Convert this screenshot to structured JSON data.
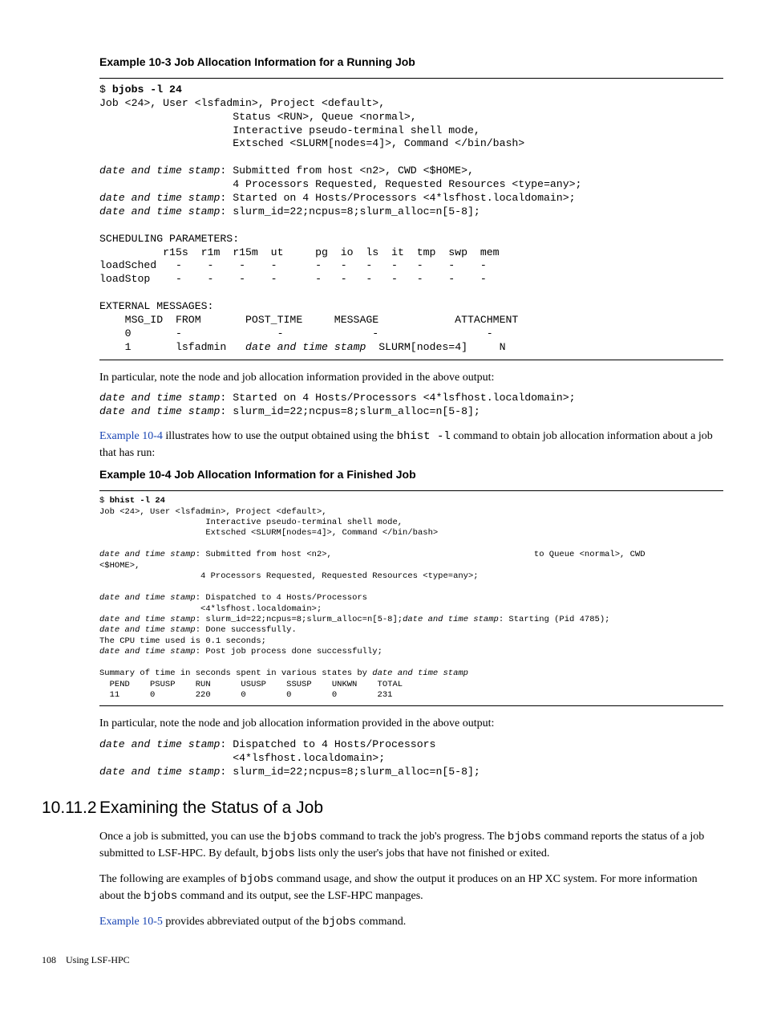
{
  "example103": {
    "heading": "Example 10-3 Job Allocation Information for a Running Job",
    "block": "$ <b>bjobs -l 24</b>\nJob <24>, User <lsfadmin>, Project <default>,\n                     Status <RUN>, Queue <normal>,\n                     Interactive pseudo-terminal shell mode,\n                     Extsched <SLURM[nodes=4]>, Command </bin/bash>\n\n<i>date and time stamp</i>: Submitted from host <n2>, CWD <$HOME>,\n                     4 Processors Requested, Requested Resources <type=any>;\n<i>date and time stamp</i>: Started on 4 Hosts/Processors <4*lsfhost.localdomain>;\n<i>date and time stamp</i>: slurm_id=22;ncpus=8;slurm_alloc=n[5-8];\n\nSCHEDULING PARAMETERS:\n          r15s  r1m  r15m  ut     pg  io  ls  it  tmp  swp  mem\nloadSched   -    -    -    -      -   -   -   -   -    -    -\nloadStop    -    -    -    -      -   -   -   -   -    -    -\n\nEXTERNAL MESSAGES:\n    MSG_ID  FROM       POST_TIME     MESSAGE            ATTACHMENT\n    0       -               -              -                 -\n    1       lsfadmin   <i>date and time stamp</i>  SLURM[nodes=4]     N"
  },
  "para1": "In particular, note the node and job allocation information provided in the above output:",
  "snippet1": "<i>date and time stamp</i>: Started on 4 Hosts/Processors <4*lsfhost.localdomain>;\n<i>date and time stamp</i>: slurm_id=22;ncpus=8;slurm_alloc=n[5-8];",
  "para2_pre": "Example 10-4",
  "para2_mid": " illustrates how to use the output obtained using the ",
  "para2_code": "bhist -l",
  "para2_post": " command to obtain job allocation information about a job that has run:",
  "example104": {
    "heading": "Example 10-4 Job Allocation Information for a Finished Job",
    "block": "$ <b>bhist -l 24</b>\nJob <24>, User <lsfadmin>, Project <default>,\n                     Interactive pseudo-terminal shell mode,\n                     Extsched <SLURM[nodes=4]>, Command </bin/bash>\n\n<i>date and time stamp</i>: Submitted from host <n2>,                                        to Queue <normal>, CWD\n<$HOME>,\n                    4 Processors Requested, Requested Resources <type=any>;\n\n<i>date and time stamp</i>: Dispatched to 4 Hosts/Processors\n                    <4*lsfhost.localdomain>;\n<i>date and time stamp</i>: slurm_id=22;ncpus=8;slurm_alloc=n[5-8];<i>date and time stamp</i>: Starting (Pid 4785);\n<i>date and time stamp</i>: Done successfully.\nThe CPU time used is 0.1 seconds;\n<i>date and time stamp</i>: Post job process done successfully;\n\nSummary of time in seconds spent in various states by <i>date and time stamp</i>\n  PEND    PSUSP    RUN      USUSP    SSUSP    UNKWN    TOTAL\n  11      0        220      0        0        0        231"
  },
  "para3": "In particular, note the node and job allocation information provided in the above output:",
  "snippet2": "<i>date and time stamp</i>: Dispatched to 4 Hosts/Processors\n                     <4*lsfhost.localdomain>;\n<i>date and time stamp</i>: slurm_id=22;ncpus=8;slurm_alloc=n[5-8];",
  "section": {
    "number": "10.11.2",
    "title": "Examining the Status of a Job"
  },
  "para4_a": "Once a job is submitted, you can use the ",
  "para4_b": "bjobs",
  "para4_c": " command to track the job's progress. The ",
  "para4_d": "bjobs",
  "para4_e": " command reports the status of a job submitted to LSF-HPC. By default, ",
  "para4_f": "bjobs",
  "para4_g": " lists only the user's jobs that have not finished or exited.",
  "para5_a": "The following are examples of ",
  "para5_b": "bjobs",
  "para5_c": " command usage, and show the output it produces on an HP XC system. For more information about the ",
  "para5_d": "bjobs",
  "para5_e": " command and its output, see the LSF-HPC manpages.",
  "para6_a": "Example 10-5",
  "para6_b": " provides abbreviated output of the ",
  "para6_c": "bjobs",
  "para6_d": " command.",
  "footer": {
    "page": "108",
    "title": "Using LSF-HPC"
  }
}
